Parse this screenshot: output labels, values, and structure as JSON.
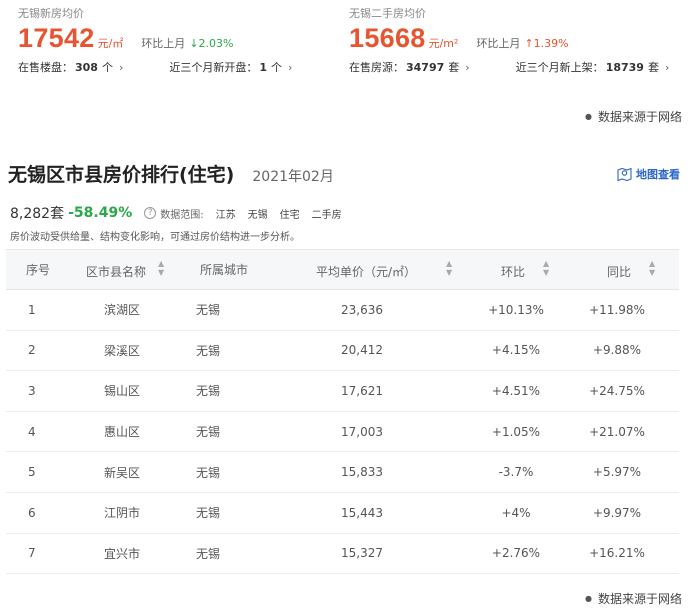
{
  "new_house": {
    "label": "无锡新房均价",
    "price": "17542",
    "unit": "元/㎡",
    "change_label": "环比上月",
    "change_value": "↓2.03%",
    "on_sale_label": "在售楼盘：",
    "on_sale_value": "308",
    "on_sale_unit": "个",
    "new_open_label": "近三个月新开盘：",
    "new_open_value": "1",
    "new_open_unit": "个"
  },
  "second_house": {
    "label": "无锡二手房均价",
    "price": "15668",
    "unit": "元/m²",
    "change_label": "环比上月",
    "change_value": "↑1.39%",
    "on_sale_label": "在售房源：",
    "on_sale_value": "34797",
    "on_sale_unit": "套",
    "new_listing_label": "近三个月新上架：",
    "new_listing_value": "18739",
    "new_listing_unit": "套"
  },
  "source_note": "数据来源于网络",
  "ranking": {
    "title": "无锡区市县房价排行(住宅)",
    "date": "2021年02月",
    "map_link": "地图查看",
    "count": "8,282套",
    "count_change": "-58.49%",
    "scope_label": "数据范围:",
    "scope_tags": [
      "江苏",
      "无锡",
      "住宅",
      "二手房"
    ],
    "description": "房价波动受供给量、结构变化影响，可通过房价结构进一步分析。",
    "headers": {
      "index": "序号",
      "name": "区市县名称",
      "city": "所属城市",
      "price": "平均单价（元/㎡）",
      "mom": "环比",
      "yoy": "同比"
    },
    "rows": [
      {
        "index": "1",
        "name": "滨湖区",
        "city": "无锡",
        "price": "23,636",
        "mom": "+10.13%",
        "yoy": "+11.98%"
      },
      {
        "index": "2",
        "name": "梁溪区",
        "city": "无锡",
        "price": "20,412",
        "mom": "+4.15%",
        "yoy": "+9.88%"
      },
      {
        "index": "3",
        "name": "锡山区",
        "city": "无锡",
        "price": "17,621",
        "mom": "+4.51%",
        "yoy": "+24.75%"
      },
      {
        "index": "4",
        "name": "惠山区",
        "city": "无锡",
        "price": "17,003",
        "mom": "+1.05%",
        "yoy": "+21.07%"
      },
      {
        "index": "5",
        "name": "新吴区",
        "city": "无锡",
        "price": "15,833",
        "mom": "-3.7%",
        "yoy": "+5.97%"
      },
      {
        "index": "6",
        "name": "江阴市",
        "city": "无锡",
        "price": "15,443",
        "mom": "+4%",
        "yoy": "+9.97%"
      },
      {
        "index": "7",
        "name": "宜兴市",
        "city": "无锡",
        "price": "15,327",
        "mom": "+2.76%",
        "yoy": "+16.21%"
      }
    ]
  },
  "colors": {
    "accent_red": "#e8542f",
    "accent_green": "#2aa84a",
    "link_blue": "#2d67c5"
  },
  "icons": {
    "chevron": "chevron-right-icon",
    "map": "map-pin-icon",
    "help": "question-icon",
    "sort": "sort-icon",
    "dot": "bullet-dot-icon"
  }
}
